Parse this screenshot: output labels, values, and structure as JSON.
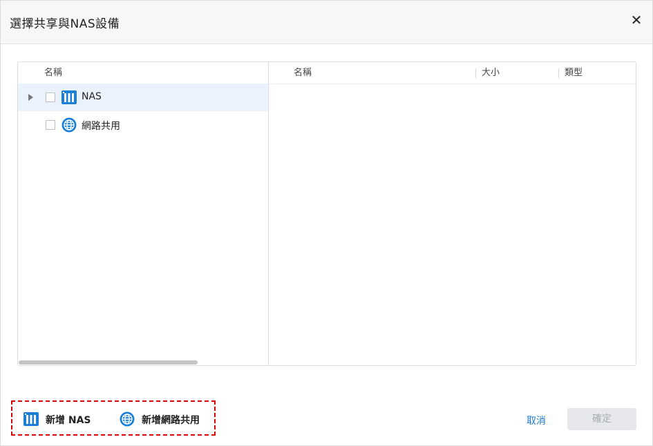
{
  "dialog": {
    "title": "選擇共享與NAS設備",
    "close_glyph": "✕"
  },
  "tree": {
    "column_name": "名稱",
    "items": [
      {
        "label": "NAS",
        "icon": "nas-icon",
        "expandable": true,
        "selected": true
      },
      {
        "label": "網路共用",
        "icon": "globe-icon",
        "expandable": false,
        "selected": false
      }
    ]
  },
  "details": {
    "columns": [
      "名稱",
      "大小",
      "類型"
    ]
  },
  "footer": {
    "add_nas_label": "新增 NAS",
    "add_share_label": "新增網路共用",
    "cancel_label": "取消",
    "confirm_label": "確定"
  },
  "colors": {
    "accent": "#1e7ad6",
    "icon_blue": "#1a7fd6",
    "highlight_border": "#d90000",
    "selected_row": "#eaf3fd"
  }
}
